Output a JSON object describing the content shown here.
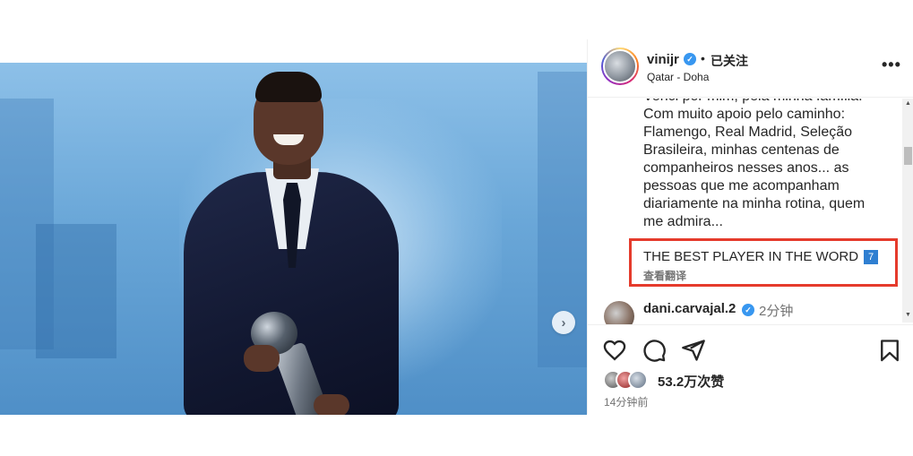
{
  "post": {
    "username": "vinijr",
    "follow_status": "已关注",
    "location": "Qatar - Doha",
    "caption_lines": [
      "Venci por mim, pela minha família.",
      "Com muito apoio pelo caminho:",
      "Flamengo, Real Madrid, Seleção",
      "Brasileira, minhas centenas de",
      "companheiros nesses anos... as",
      "pessoas que me acompanham",
      "diariamente na minha rotina, quem",
      "me admira..."
    ],
    "highlight_text": "THE BEST PLAYER IN THE WORD",
    "highlight_badge": "7",
    "translate_label": "查看翻译",
    "likes": "53.2万次赞",
    "time_ago": "14分钟前"
  },
  "comment": {
    "username": "dani.carvajal.2",
    "time": "2分钟"
  },
  "icons": {
    "more": "more-options-icon",
    "heart": "heart-icon",
    "comment": "comment-icon",
    "share": "share-icon",
    "save": "save-icon",
    "next": "chevron-right-icon",
    "verified": "verified-badge-icon"
  },
  "colors": {
    "highlight_border": "#e53b2c",
    "verified": "#3897f0",
    "badge": "#2f7fd1"
  }
}
